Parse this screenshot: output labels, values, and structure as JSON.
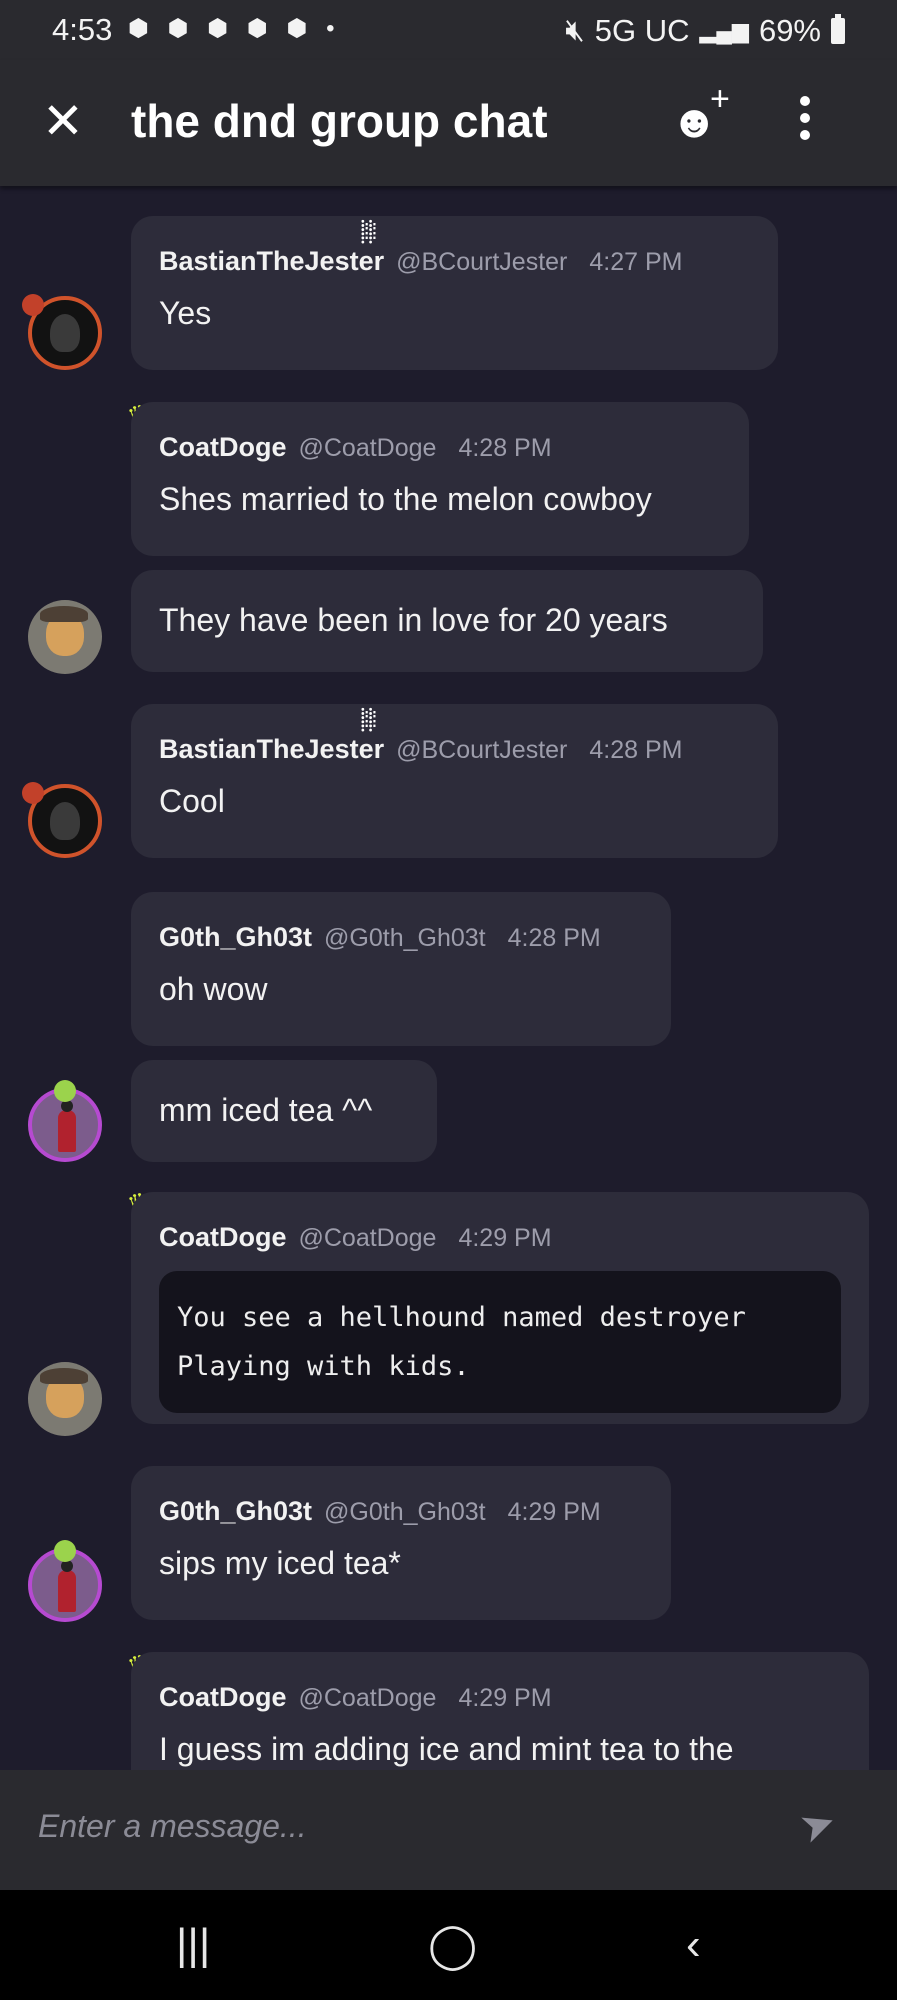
{
  "status_bar": {
    "time": "4:53",
    "notification_icons": "⬢ ⬢ ⬢ ⬢ ⬢ •",
    "network": "5G UC",
    "battery": "69%"
  },
  "header": {
    "title": "the dnd group chat"
  },
  "messages": [
    {
      "name": "BastianTheJester",
      "handle": "@BCourtJester",
      "time": "4:27 PM",
      "text": "Yes"
    },
    {
      "name": "CoatDoge",
      "handle": "@CoatDoge",
      "time": "4:28 PM",
      "text": "Shes married to the melon cowboy"
    },
    {
      "text": "They have been in love for 20 years"
    },
    {
      "name": "BastianTheJester",
      "handle": "@BCourtJester",
      "time": "4:28 PM",
      "text": "Cool"
    },
    {
      "name": "G0th_Gh03t",
      "handle": "@G0th_Gh03t",
      "time": "4:28 PM",
      "text": "oh wow"
    },
    {
      "text": "mm iced tea ^^"
    },
    {
      "name": "CoatDoge",
      "handle": "@CoatDoge",
      "time": "4:29 PM",
      "code_line1": "You see a hellhound named destroyer",
      "code_line2": "Playing with kids."
    },
    {
      "name": "G0th_Gh03t",
      "handle": "@G0th_Gh03t",
      "time": "4:29 PM",
      "text": "sips my iced tea*"
    },
    {
      "name": "CoatDoge",
      "handle": "@CoatDoge",
      "time": "4:29 PM",
      "text": "I guess im adding ice and mint tea to the"
    }
  ],
  "composer": {
    "placeholder": "Enter a message..."
  },
  "colors": {
    "background": "#1e1c2c",
    "bubble": "#2d2c3a",
    "bar": "#2a2a2f",
    "crown": "#d7ef3d"
  }
}
